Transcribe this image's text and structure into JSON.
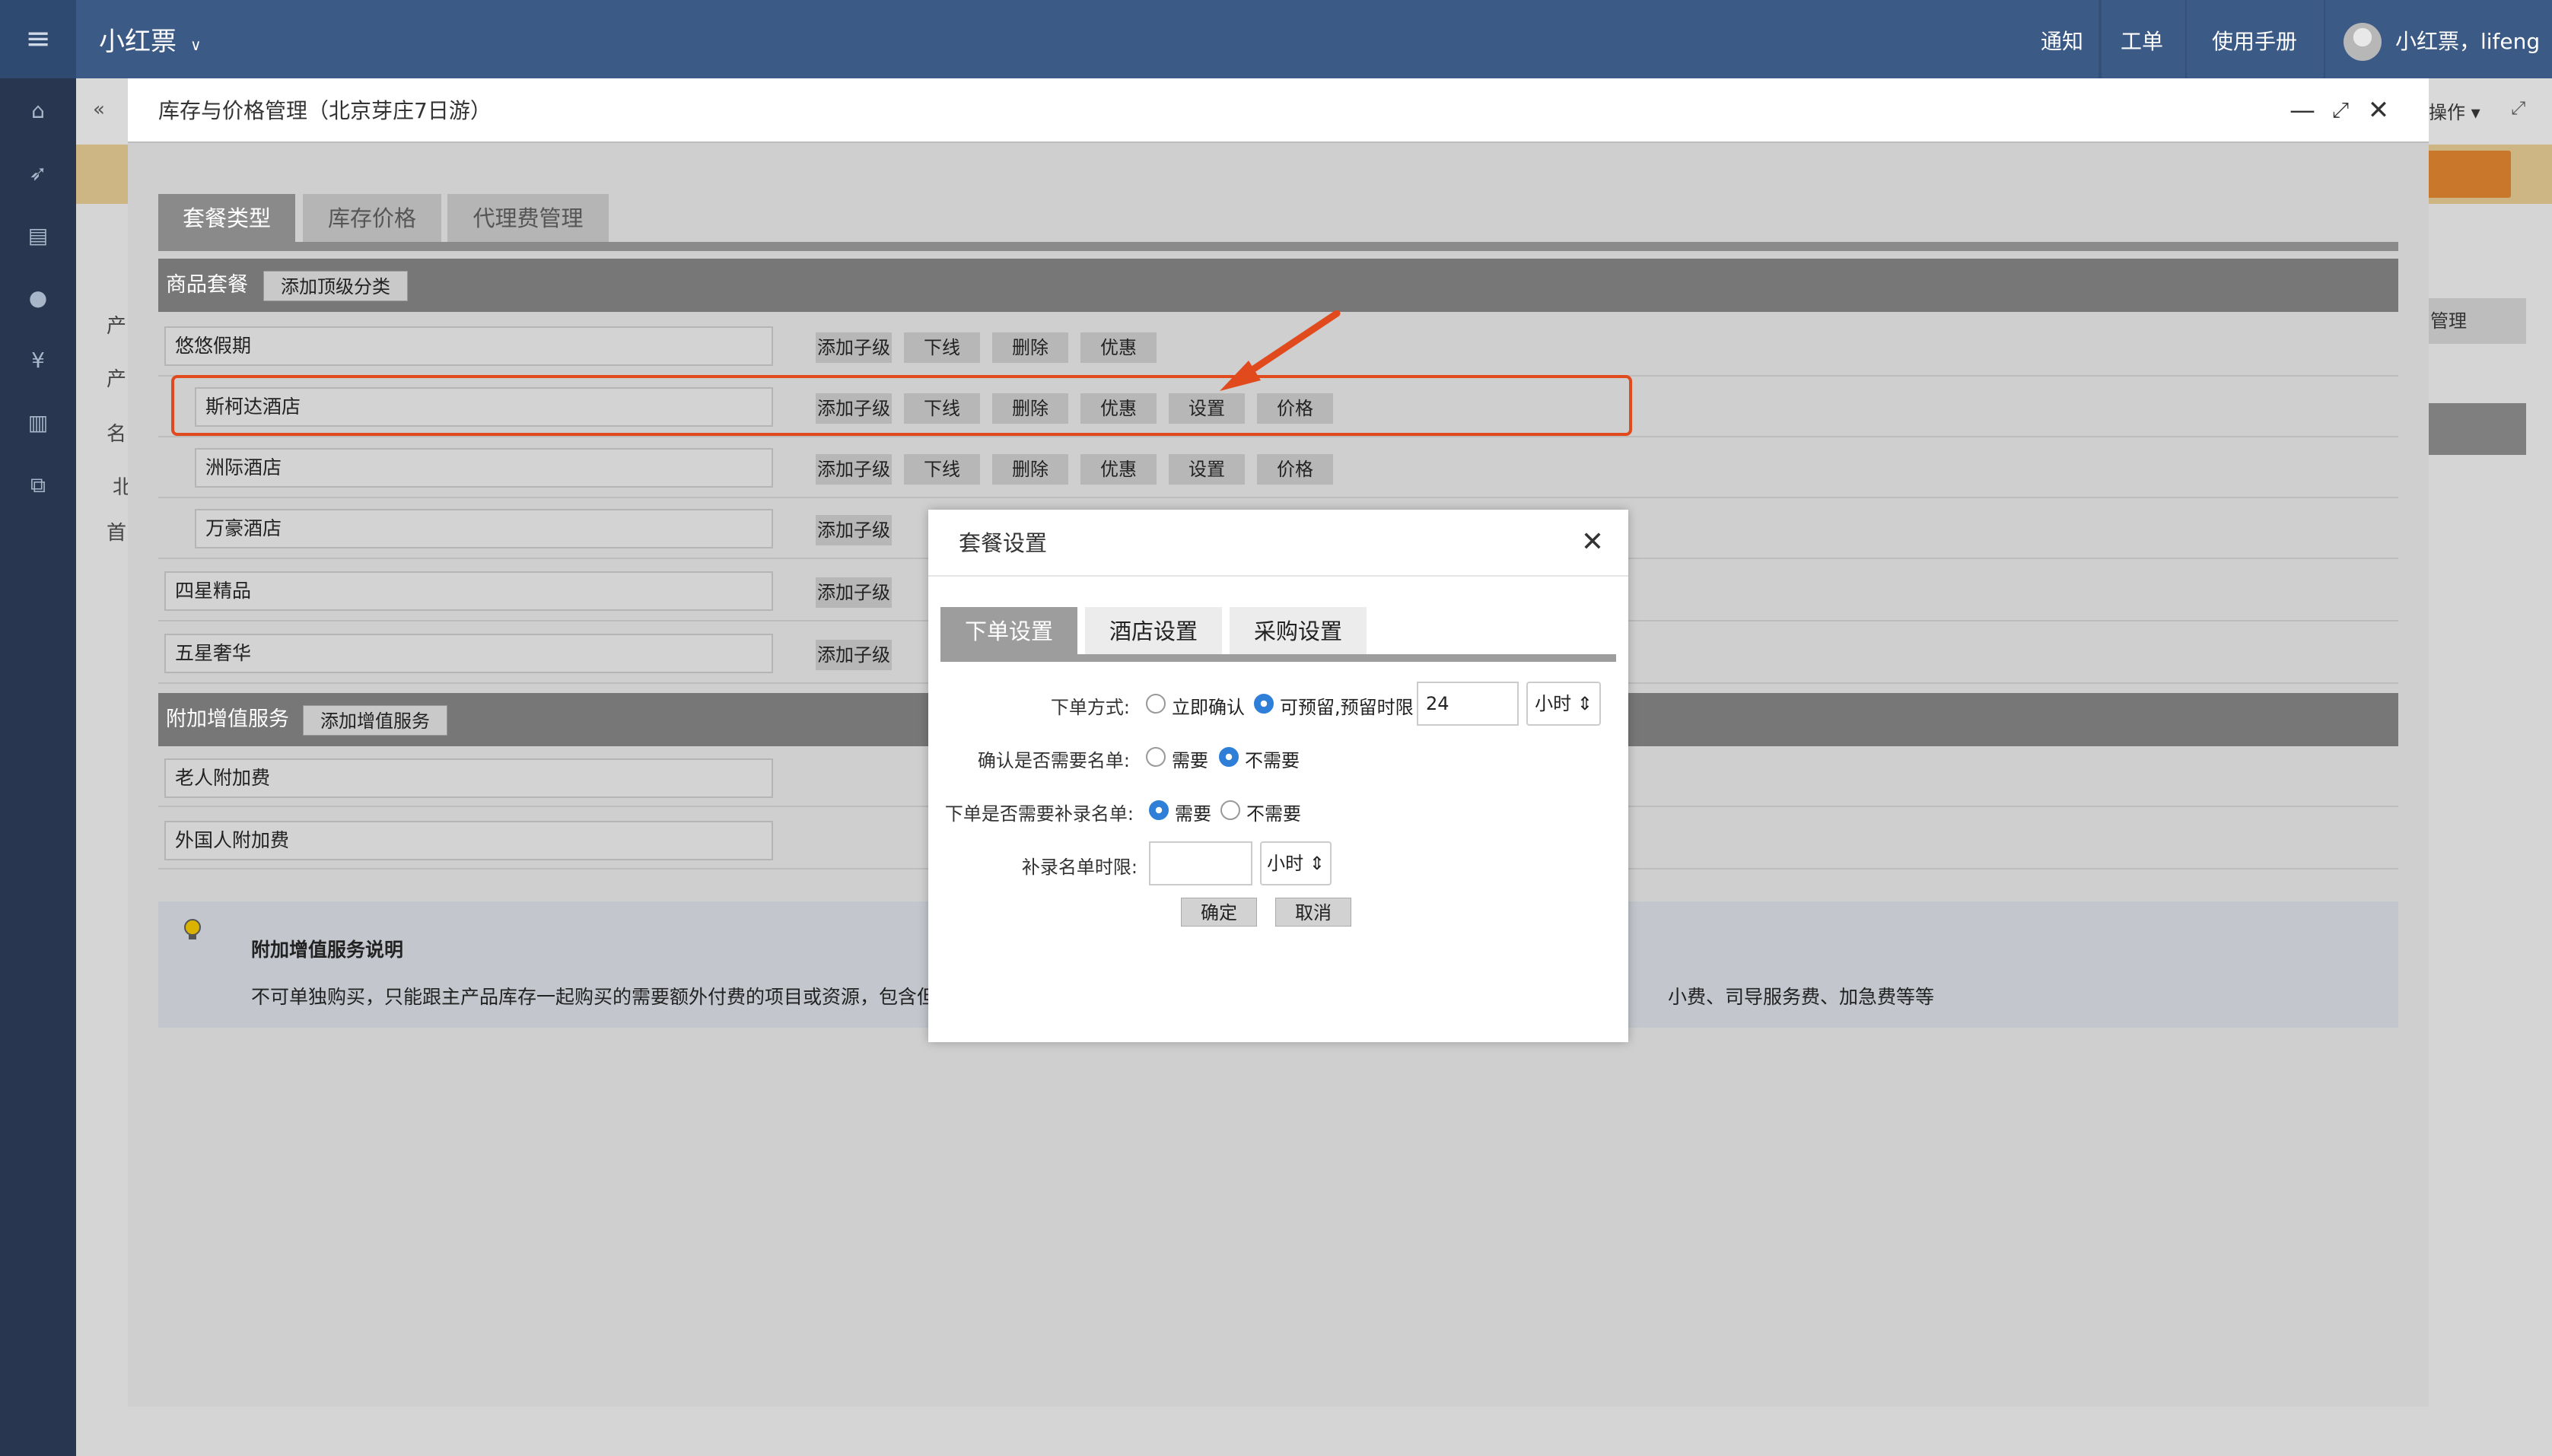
{
  "app": {
    "menu_icon": "hamburger-icon",
    "brand": "小红票",
    "nav": [
      "通知",
      "工单",
      "使用手册"
    ],
    "user": "小红票，lifeng"
  },
  "sidebar_icons": [
    "home-icon",
    "rocket-icon",
    "list-icon",
    "user-icon",
    "yen-icon",
    "bar-chart-icon",
    "sitemap-icon"
  ],
  "background": {
    "ops_label": "操作",
    "manage_label": "管理",
    "left_fragments": [
      "产",
      "产",
      "名",
      "北",
      "首"
    ]
  },
  "window": {
    "title": "库存与价格管理（北京芽庄7日游）",
    "tabs": [
      "套餐类型",
      "库存价格",
      "代理费管理"
    ],
    "package_section": {
      "label": "商品套餐",
      "add_button": "添加顶级分类",
      "rows": [
        {
          "name": "悠悠假期",
          "actions": [
            "添加子级",
            "下线",
            "删除",
            "优惠"
          ]
        },
        {
          "name": "斯柯达酒店",
          "actions": [
            "添加子级",
            "下线",
            "删除",
            "优惠",
            "设置",
            "价格"
          ]
        },
        {
          "name": "洲际酒店",
          "actions": [
            "添加子级",
            "下线",
            "删除",
            "优惠",
            "设置",
            "价格"
          ]
        },
        {
          "name": "万豪酒店",
          "actions": [
            "添加子级"
          ]
        },
        {
          "name": "四星精品",
          "actions": [
            "添加子级"
          ]
        },
        {
          "name": "五星奢华",
          "actions": [
            "添加子级"
          ]
        }
      ]
    },
    "addon_section": {
      "label": "附加增值服务",
      "add_button": "添加增值服务",
      "rows": [
        {
          "name": "老人附加费"
        },
        {
          "name": "外国人附加费"
        }
      ]
    },
    "info": {
      "title": "附加增值服务说明",
      "text": "不可单独购买，只能跟主产品库存一起购买的需要额外付费的项目或资源，包含但不",
      "text_tail": "小费、司导服务费、加急费等等"
    }
  },
  "dialog": {
    "title": "套餐设置",
    "tabs": [
      "下单设置",
      "酒店设置",
      "采购设置"
    ],
    "fields": {
      "order_method": {
        "label": "下单方式:",
        "options": [
          "立即确认",
          "可预留,预留时限"
        ],
        "selected": 1,
        "value": "24",
        "unit": "小时"
      },
      "confirm_list": {
        "label": "确认是否需要名单:",
        "options": [
          "需要",
          "不需要"
        ],
        "selected": 1
      },
      "supplement_list": {
        "label": "下单是否需要补录名单:",
        "options": [
          "需要",
          "不需要"
        ],
        "selected": 0
      },
      "supplement_time": {
        "label": "补录名单时限:",
        "value": "",
        "unit": "小时"
      }
    },
    "confirm": "确定",
    "cancel": "取消"
  },
  "colors": {
    "navbar": "#3c5a86",
    "sidebar": "#28374f",
    "highlight": "#e14a1d",
    "radio_on": "#2f7fd9"
  }
}
